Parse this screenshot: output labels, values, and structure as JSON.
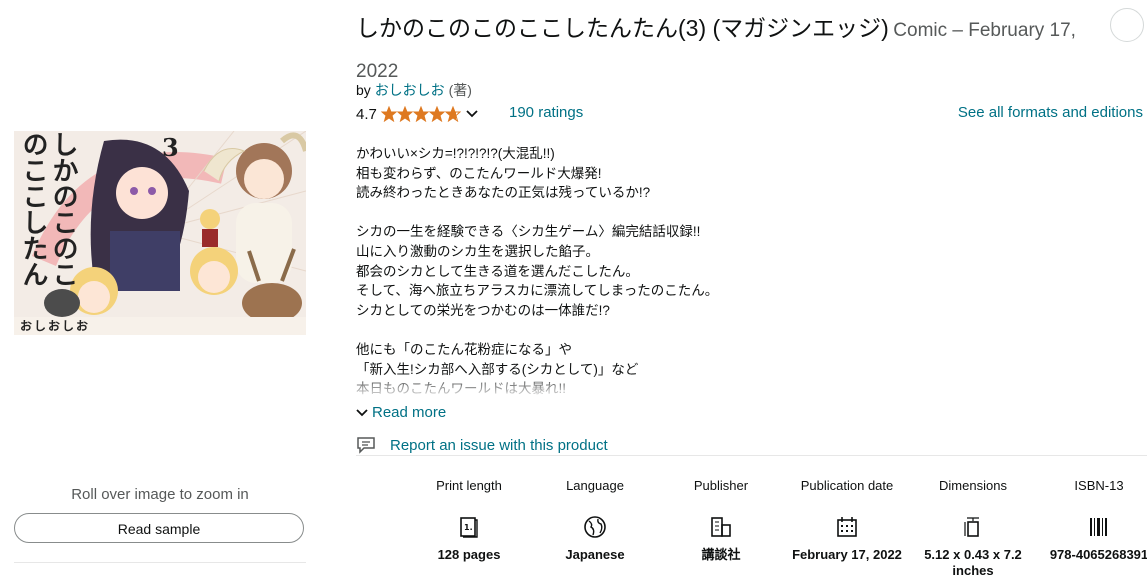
{
  "product": {
    "title": "しかのこのこのここしたんたん(3) (マガジンエッジ)",
    "format_date": "Comic – February 17, 2022",
    "author_prefix": "by",
    "author": "おしおしお",
    "author_role": "(著)",
    "rating": "4.7",
    "stars_fraction": 0.94,
    "ratings_count": "190 ratings",
    "formats_link": "See all formats and editions"
  },
  "cover": {
    "title_vertical": "しかのこのこのここしたんたん",
    "volume": "3",
    "author_mark": "おしおしお",
    "zoom_hint": "Roll over image to zoom in",
    "read_sample": "Read sample"
  },
  "description": {
    "lines": [
      "かわいい×シカ=!?!?!?!?(大混乱!!)",
      "相も変わらず、のこたんワールド大爆発!",
      "読み終わったときあなたの正気は残っているか!?",
      "",
      "シカの一生を経験できる〈シカ生ゲーム〉編完結話収録!!",
      "山に入り激動のシカ生を選択した餡子。",
      "都会のシカとして生きる道を選んだこしたん。",
      "そして、海へ旅立ちアラスカに漂流してしまったのこたん。",
      "シカとしての栄光をつかむのは一体誰だ!?",
      "",
      "他にも「のこたん花粉症になる」や",
      "「新入生!シカ部へ入部する(シカとして)」など",
      "本日ものこたんワールドは大暴れ!!"
    ],
    "read_more": "Read more"
  },
  "report": {
    "label": "Report an issue with this product"
  },
  "details": [
    {
      "label": "Print length",
      "icon": "book-pages-icon",
      "value": "128 pages"
    },
    {
      "label": "Language",
      "icon": "globe-icon",
      "value": "Japanese"
    },
    {
      "label": "Publisher",
      "icon": "building-icon",
      "value": "講談社"
    },
    {
      "label": "Publication date",
      "icon": "calendar-icon",
      "value": "February 17, 2022"
    },
    {
      "label": "Dimensions",
      "icon": "dimensions-icon",
      "value": "5.12 x 0.43 x 7.2 inches"
    },
    {
      "label": "ISBN-13",
      "icon": "barcode-icon",
      "value": "978-4065268391"
    }
  ],
  "colors": {
    "link": "#007185",
    "star": "#de7921",
    "text": "#0f1111",
    "muted": "#565959"
  }
}
